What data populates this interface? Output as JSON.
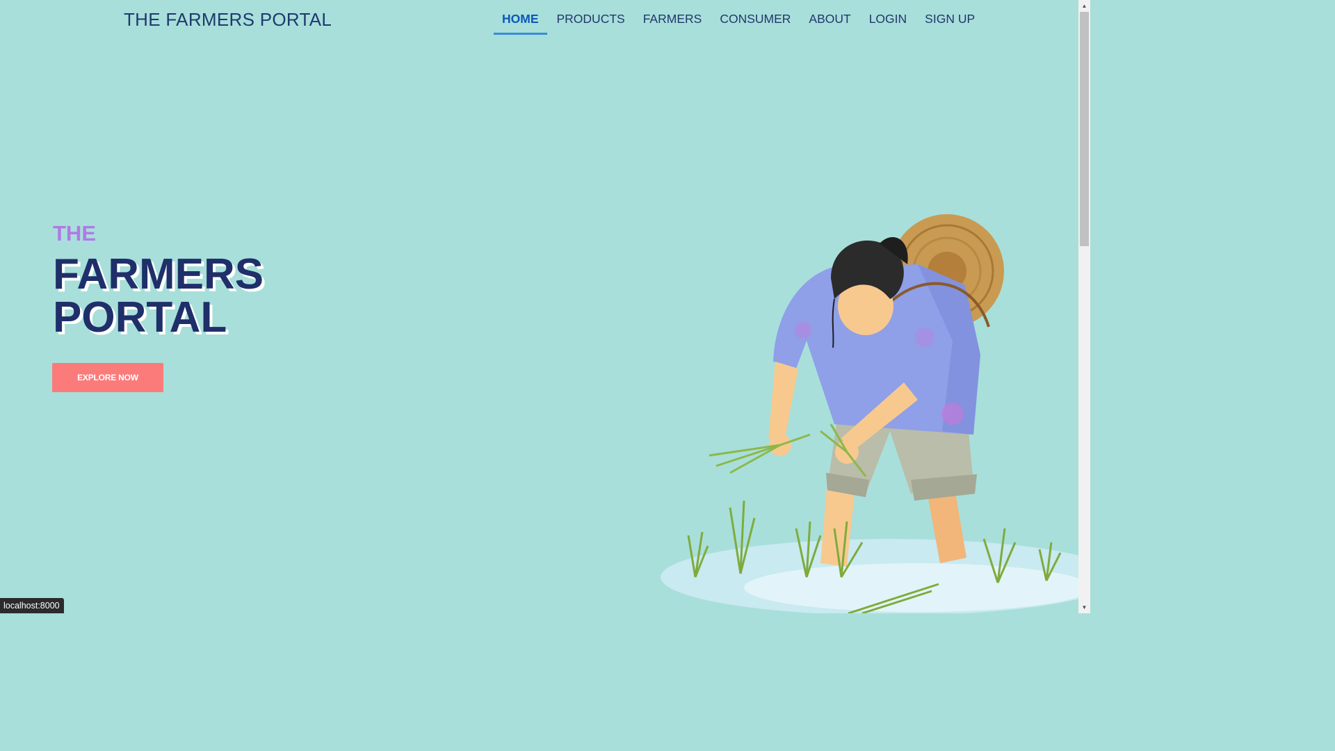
{
  "header": {
    "brand": "THE FARMERS PORTAL",
    "nav": [
      {
        "label": "HOME",
        "active": true
      },
      {
        "label": "PRODUCTS"
      },
      {
        "label": "FARMERS"
      },
      {
        "label": "CONSUMER"
      },
      {
        "label": "ABOUT"
      },
      {
        "label": "LOGIN"
      },
      {
        "label": "SIGN UP"
      }
    ]
  },
  "hero": {
    "eyebrow": "THE",
    "title_line1": "FARMERS",
    "title_line2": "PORTAL",
    "cta_label": "EXPLORE NOW"
  },
  "illustration": {
    "icon": "farmer-planting-rice-illustration"
  },
  "status_bar": {
    "url": "localhost:8000"
  },
  "colors": {
    "background": "#a8dfda",
    "brand_text": "#1f3a6e",
    "nav_active": "#0d57b8",
    "eyebrow": "#b07ae6",
    "title": "#1f2f6a",
    "cta": "#fb7b7b"
  }
}
